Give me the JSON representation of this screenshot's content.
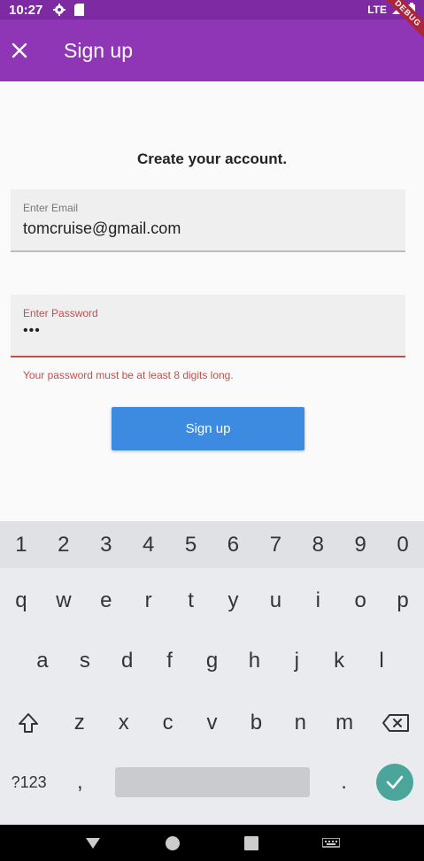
{
  "status_bar": {
    "time": "10:27",
    "network": "LTE",
    "icons": [
      "settings-icon",
      "sim-card-icon",
      "signal-icon",
      "battery-icon"
    ]
  },
  "debug_banner": "DEBUG",
  "app_bar": {
    "title": "Sign up",
    "background": "#8e36b5",
    "close_icon": "close-icon"
  },
  "form": {
    "heading": "Create your account.",
    "email": {
      "label": "Enter Email",
      "value": "tomcruise@gmail.com"
    },
    "password": {
      "label": "Enter Password",
      "value": "•••",
      "error": "Your password must be at least 8 digits long.",
      "error_color": "#c0504d"
    },
    "submit_label": "Sign up",
    "submit_color": "#3d8be0"
  },
  "keyboard": {
    "numbers": [
      "1",
      "2",
      "3",
      "4",
      "5",
      "6",
      "7",
      "8",
      "9",
      "0"
    ],
    "row1": [
      "q",
      "w",
      "e",
      "r",
      "t",
      "y",
      "u",
      "i",
      "o",
      "p"
    ],
    "row2": [
      "a",
      "s",
      "d",
      "f",
      "g",
      "h",
      "j",
      "k",
      "l"
    ],
    "row3": [
      "z",
      "x",
      "c",
      "v",
      "b",
      "n",
      "m"
    ],
    "symbols_label": "?123",
    "comma": ",",
    "period": ".",
    "shift_icon": "shift-icon",
    "backspace_icon": "backspace-icon",
    "enter_icon": "check-icon",
    "enter_color": "#4aa69a"
  },
  "nav_bar": {
    "icons": [
      "back-icon",
      "home-icon",
      "recents-icon",
      "keyboard-switch-icon"
    ]
  }
}
